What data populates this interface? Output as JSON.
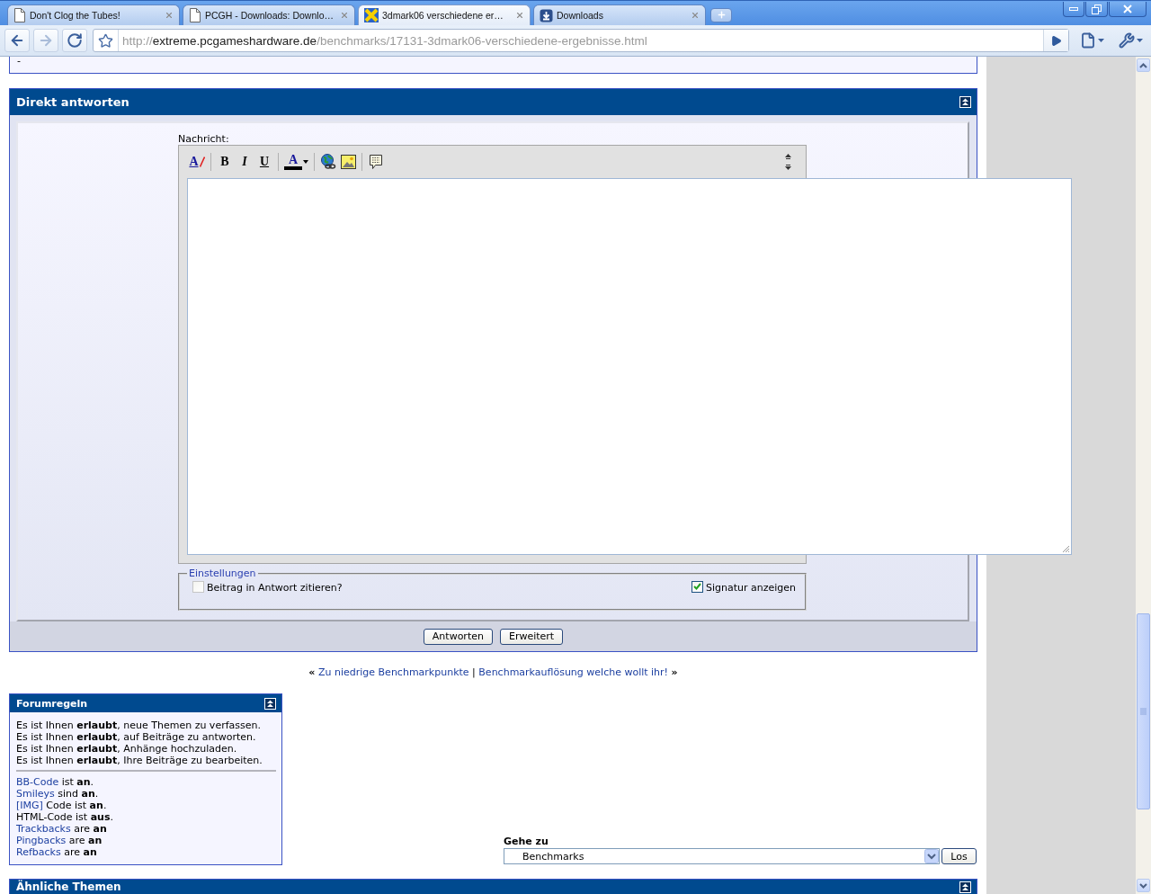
{
  "browser": {
    "tabs": [
      {
        "title": "Don't Clog the Tubes!",
        "selected": false,
        "kind": "page"
      },
      {
        "title": "PCGH - Downloads: Downlo…",
        "selected": false,
        "kind": "page"
      },
      {
        "title": "3dmark06 verschiedene er…",
        "selected": true,
        "kind": "site"
      },
      {
        "title": "Downloads",
        "selected": false,
        "kind": "download"
      }
    ],
    "nav_buttons": [
      {
        "kind": "back",
        "disabled": false
      },
      {
        "kind": "forward",
        "disabled": true
      },
      {
        "kind": "reload",
        "disabled": false
      }
    ],
    "url": {
      "scheme": "http://",
      "host": "extreme.pcgameshardware.de",
      "path": "/benchmarks/17131-3dmark06-verschiedene-ergebnisse.html"
    }
  },
  "previous_post": {
    "text": "-"
  },
  "reply_panel": {
    "title": "Direkt antworten",
    "message_label": "Nachricht:",
    "toolbar": [
      [
        {
          "kind": "clear",
          "glyph": "A"
        }
      ],
      [
        {
          "kind": "bold",
          "glyph": "B"
        },
        {
          "kind": "italic",
          "glyph": "I"
        },
        {
          "kind": "underline",
          "glyph": "U"
        }
      ],
      [
        {
          "kind": "color",
          "glyph": "A"
        }
      ],
      [
        {
          "kind": "link"
        },
        {
          "kind": "image"
        }
      ],
      [
        {
          "kind": "quote"
        }
      ]
    ],
    "settings": {
      "legend": "Einstellungen",
      "options": [
        {
          "label": "Beitrag in Antwort zitieren?",
          "checked": false
        },
        {
          "label": "Signatur anzeigen",
          "checked": true
        }
      ]
    },
    "buttons": [
      "Antworten",
      "Erweitert"
    ]
  },
  "thread_nav": {
    "prev_mark": "«",
    "prev": "Zu niedrige Benchmarkpunkte",
    "separator": "|",
    "next": "Benchmarkauflösung welche wollt ihr!",
    "next_mark": "»"
  },
  "forum_rules": {
    "title": "Forumregeln",
    "permissions": [
      "Es ist Ihnen **erlaubt**, neue Themen zu verfassen.",
      "Es ist Ihnen **erlaubt**, auf Beiträge zu antworten.",
      "Es ist Ihnen **erlaubt**, Anhänge hochzuladen.",
      "Es ist Ihnen **erlaubt**, Ihre Beiträge zu bearbeiten."
    ],
    "settings": [
      {
        "link": "BB-Code",
        "rest": "ist **an**."
      },
      {
        "link": "Smileys",
        "rest": "sind **an**."
      },
      {
        "link": "[IMG]",
        "rest": "Code ist **an**."
      },
      {
        "rest": "HTML-Code ist **aus**."
      },
      {
        "link": "Trackbacks",
        "rest": "are **an**"
      },
      {
        "link": "Pingbacks",
        "rest": "are **an**"
      },
      {
        "link": "Refbacks",
        "rest": "are **an**"
      }
    ]
  },
  "goto": {
    "label": "Gehe zu",
    "value": "Benchmarks",
    "button": "Los"
  },
  "similar_threads": {
    "title": "Ähnliche Themen"
  }
}
